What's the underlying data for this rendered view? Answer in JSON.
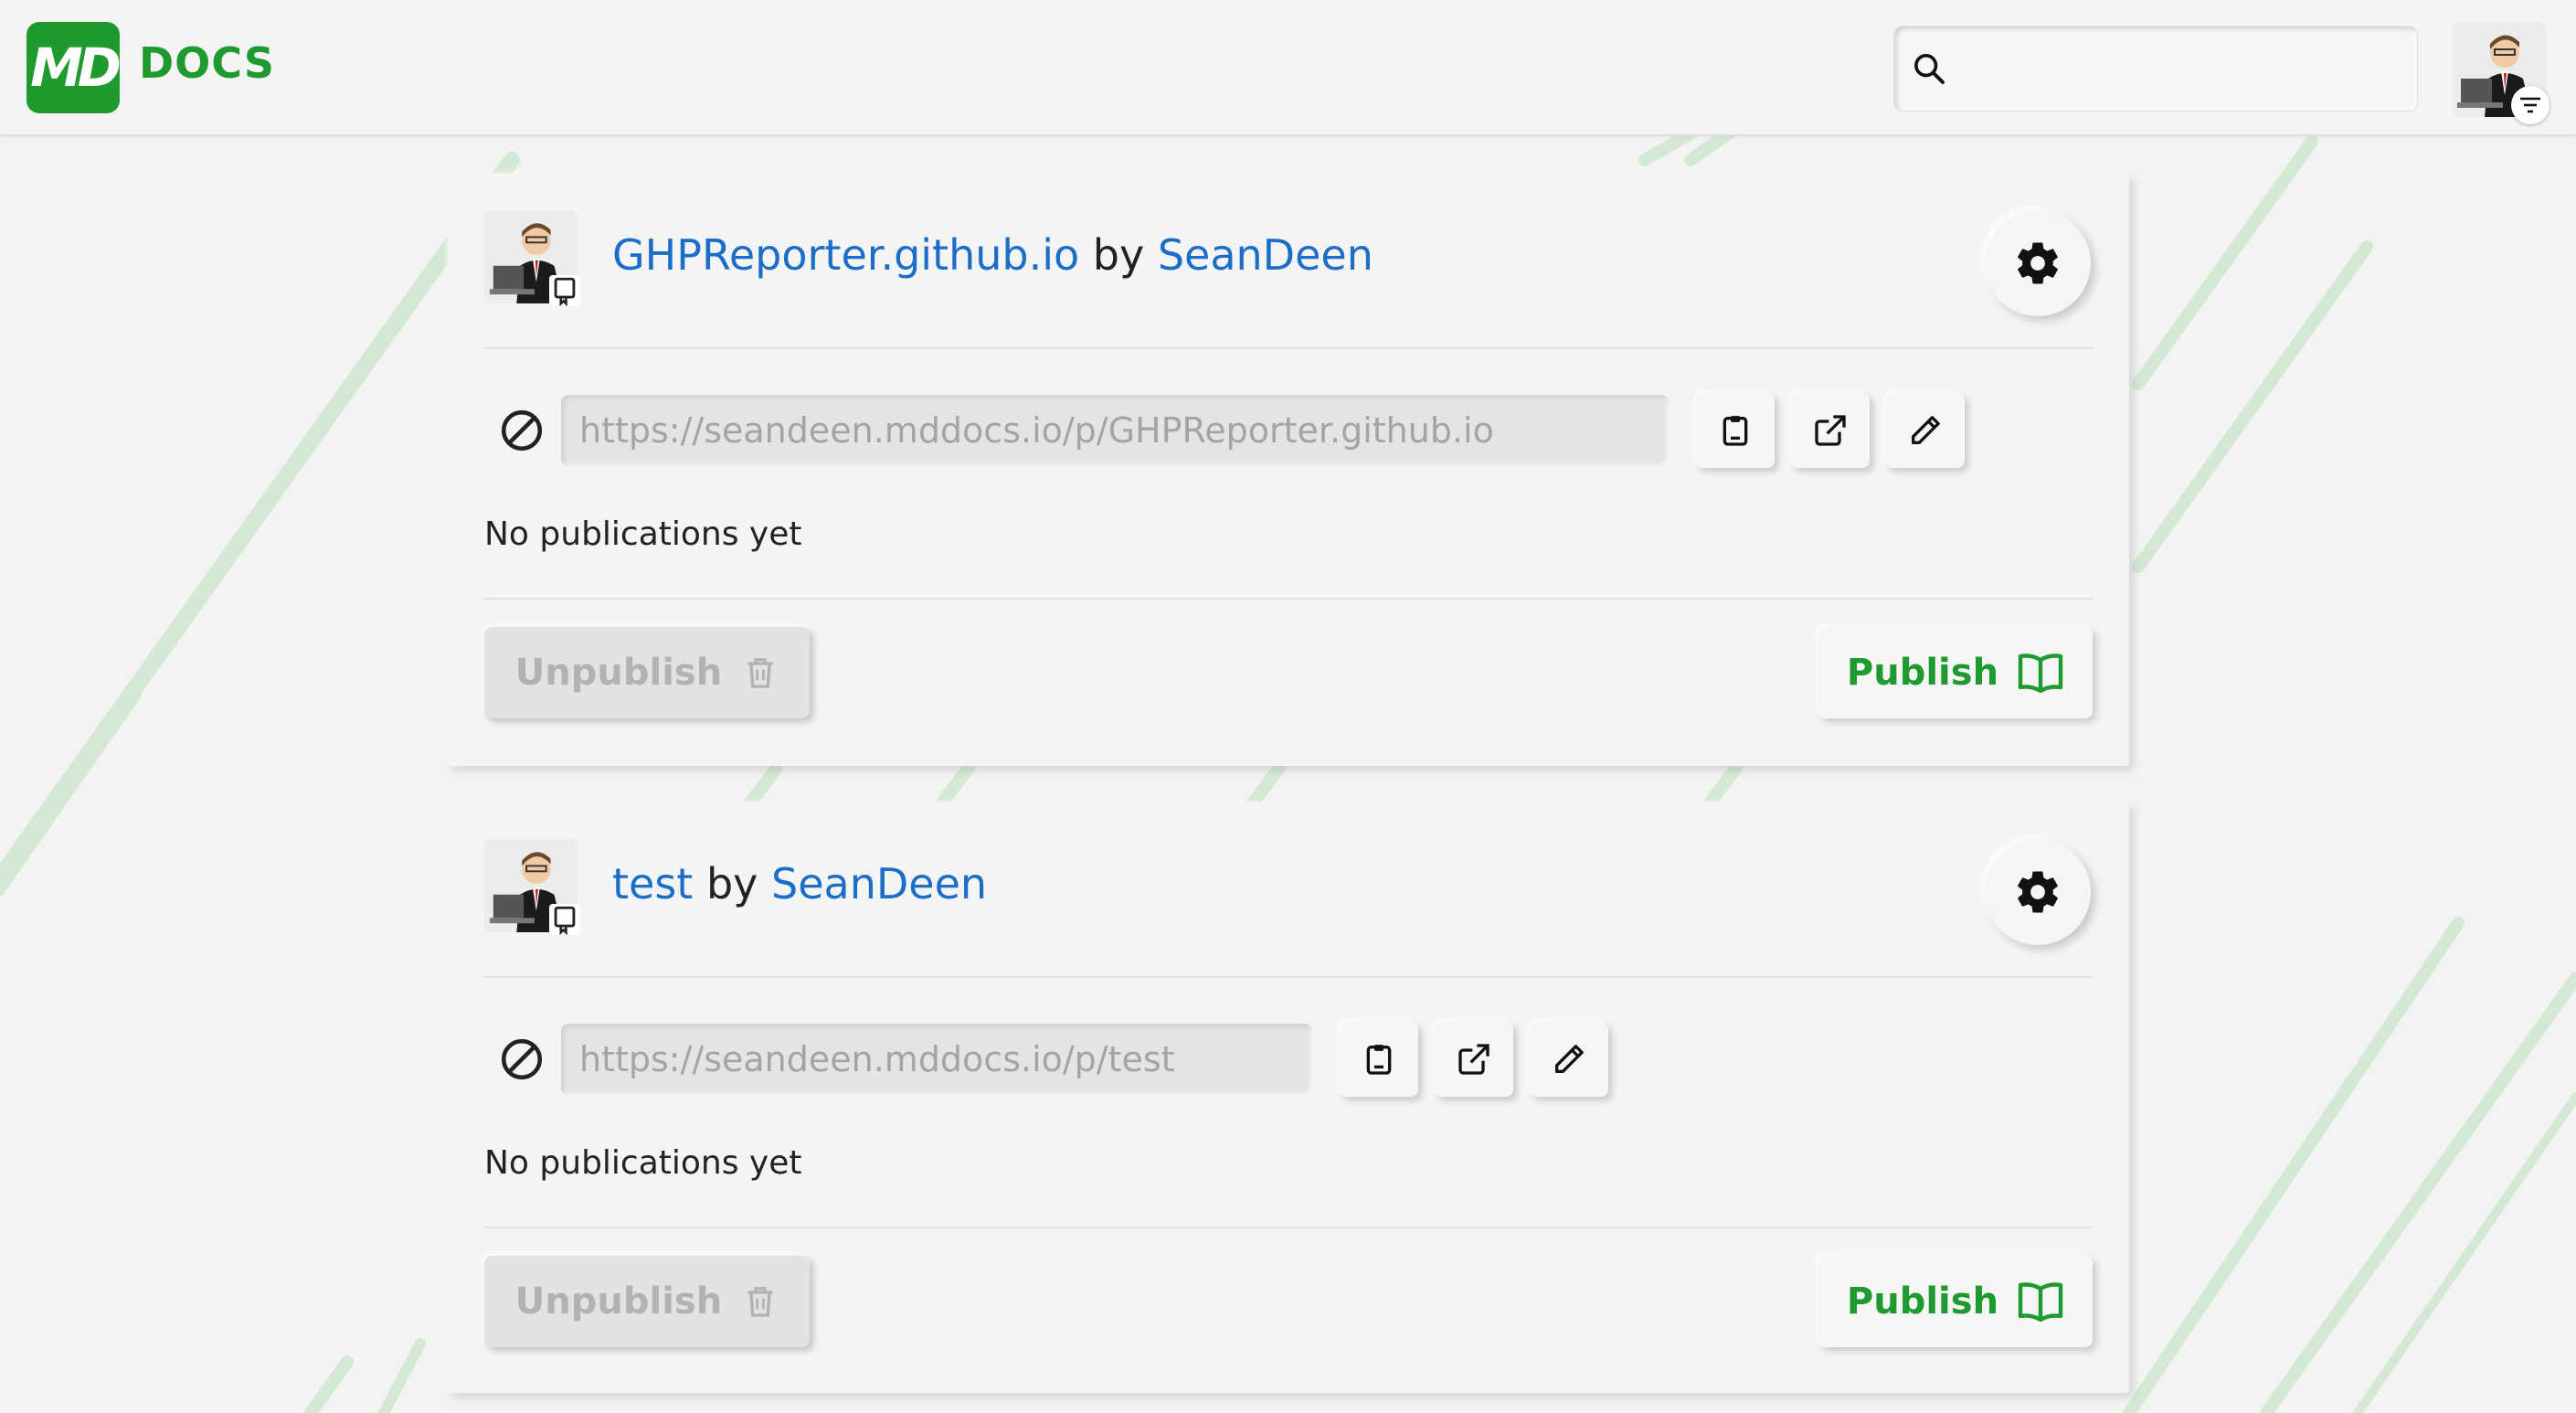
{
  "app": {
    "logo_mark": "MD",
    "logo_text": "DOCS"
  },
  "search": {
    "value": "",
    "placeholder": ""
  },
  "colors": {
    "brand": "#1e9a2f",
    "link": "#1a6ec8"
  },
  "projects": [
    {
      "name": "GHPReporter.github.io",
      "by": "by",
      "owner": "SeanDeen",
      "url": "https://seandeen.mddocs.io/p/GHPReporter.github.io",
      "status": "No publications yet",
      "unpublish_label": "Unpublish",
      "publish_label": "Publish"
    },
    {
      "name": "test",
      "by": "by",
      "owner": "SeanDeen",
      "url": "https://seandeen.mddocs.io/p/test",
      "status": "No publications yet",
      "unpublish_label": "Unpublish",
      "publish_label": "Publish"
    }
  ],
  "icons": {
    "search": "search-icon",
    "menu": "menu-lines-icon",
    "settings": "gear-icon",
    "blocked": "blocked-icon",
    "copy": "clipboard-icon",
    "open": "external-link-icon",
    "edit": "pencil-icon",
    "delete": "trash-icon",
    "book": "book-icon"
  }
}
